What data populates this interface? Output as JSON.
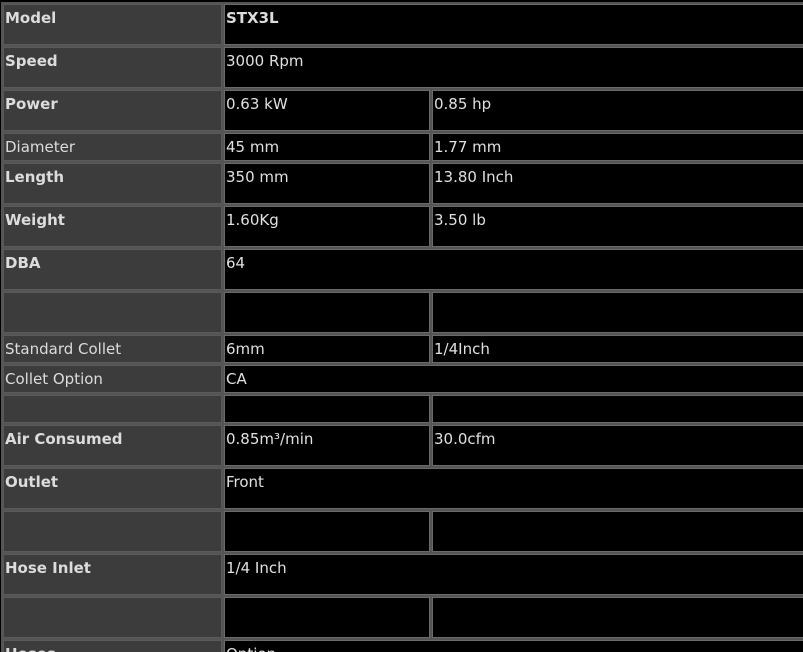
{
  "spec_table": {
    "rows": [
      {
        "label": "Model",
        "bold": true,
        "values": [
          "STX3L"
        ],
        "value_bold": true,
        "size": "tall"
      },
      {
        "label": "Speed",
        "bold": true,
        "values": [
          "3000 Rpm"
        ],
        "size": "tall"
      },
      {
        "label": "Power",
        "bold": true,
        "values": [
          "0.63 kW",
          "0.85 hp"
        ],
        "size": "tall"
      },
      {
        "label": "Diameter",
        "bold": false,
        "values": [
          "45 mm",
          "1.77 mm"
        ],
        "size": "short"
      },
      {
        "label": "Length",
        "bold": true,
        "values": [
          "350 mm",
          "13.80 Inch"
        ],
        "size": "tall"
      },
      {
        "label": "Weight",
        "bold": true,
        "values": [
          "1.60Kg",
          "3.50 lb"
        ],
        "size": "tall"
      },
      {
        "label": "DBA",
        "bold": true,
        "values": [
          "64"
        ],
        "size": "tall"
      },
      {
        "label": "",
        "bold": true,
        "values": [
          "",
          ""
        ],
        "size": "tall"
      },
      {
        "label": "Standard Collet",
        "bold": false,
        "values": [
          "6mm",
          "1/4Inch"
        ],
        "size": "short"
      },
      {
        "label": "Collet Option",
        "bold": false,
        "values": [
          "CA"
        ],
        "size": "short"
      },
      {
        "label": "",
        "bold": false,
        "values": [
          "",
          ""
        ],
        "size": "short"
      },
      {
        "label": "Air Consumed",
        "bold": true,
        "values": [
          "0.85m³/min",
          "30.0cfm"
        ],
        "size": "tall"
      },
      {
        "label": "Outlet",
        "bold": true,
        "values": [
          "Front"
        ],
        "size": "tall"
      },
      {
        "label": "",
        "bold": true,
        "values": [
          "",
          ""
        ],
        "size": "tall"
      },
      {
        "label": "Hose Inlet",
        "bold": true,
        "values": [
          "1/4 Inch"
        ],
        "size": "tall"
      },
      {
        "label": "",
        "bold": true,
        "values": [
          "",
          ""
        ],
        "size": "tall"
      },
      {
        "label": "Hoses",
        "bold": true,
        "values": [
          "Option"
        ],
        "size": "tall"
      }
    ]
  }
}
